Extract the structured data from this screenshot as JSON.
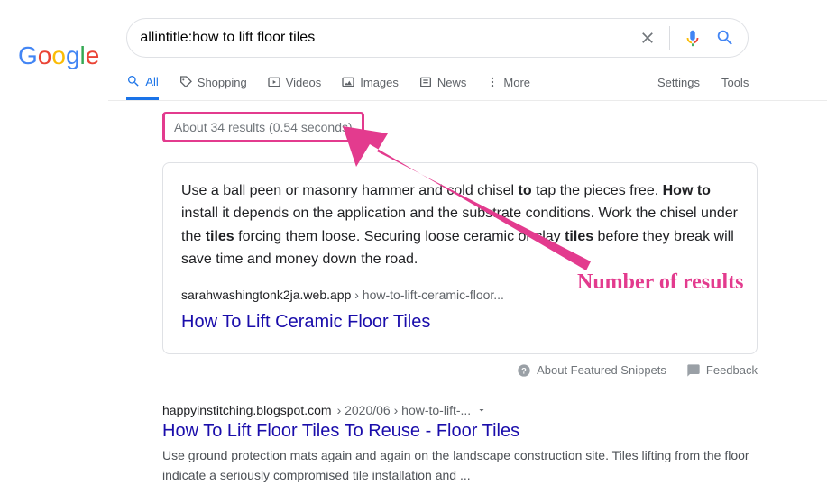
{
  "logo": {
    "g1": "G",
    "o1": "o",
    "o2": "o",
    "g2": "g",
    "l": "l",
    "e": "e"
  },
  "search": {
    "value": "allintitle:how to lift floor tiles"
  },
  "tabs": {
    "all": "All",
    "shopping": "Shopping",
    "videos": "Videos",
    "images": "Images",
    "news": "News",
    "more": "More"
  },
  "tools": {
    "settings": "Settings",
    "tools": "Tools"
  },
  "stats": "About 34 results (0.54 seconds)",
  "featured": {
    "text_pre": "Use a ball peen or masonry hammer and cold chisel ",
    "b1": "to",
    "text_mid1": " tap the pieces free. ",
    "b2": "How to",
    "text_mid2": " install it depends on the application and the substrate conditions. Work the chisel under the ",
    "b3": "tiles",
    "text_mid3": " forcing them loose. Securing loose ceramic or clay ",
    "b4": "tiles",
    "text_end": " before they break will save time and money down the road.",
    "domain": "sarahwashingtonk2ja.web.app",
    "crumbs": " › how-to-lift-ceramic-floor...",
    "title": "How To Lift Ceramic Floor Tiles"
  },
  "meta": {
    "about": "About Featured Snippets",
    "feedback": "Feedback"
  },
  "result2": {
    "domain": "happyinstitching.blogspot.com",
    "crumbs": " › 2020/06 › how-to-lift-...",
    "title": "How To Lift Floor Tiles To Reuse - Floor Tiles",
    "snippet": "Use ground protection mats again and again on the landscape construction site. Tiles lifting from the floor indicate a seriously compromised tile installation and ..."
  },
  "annotation": {
    "label": "Number of results"
  }
}
